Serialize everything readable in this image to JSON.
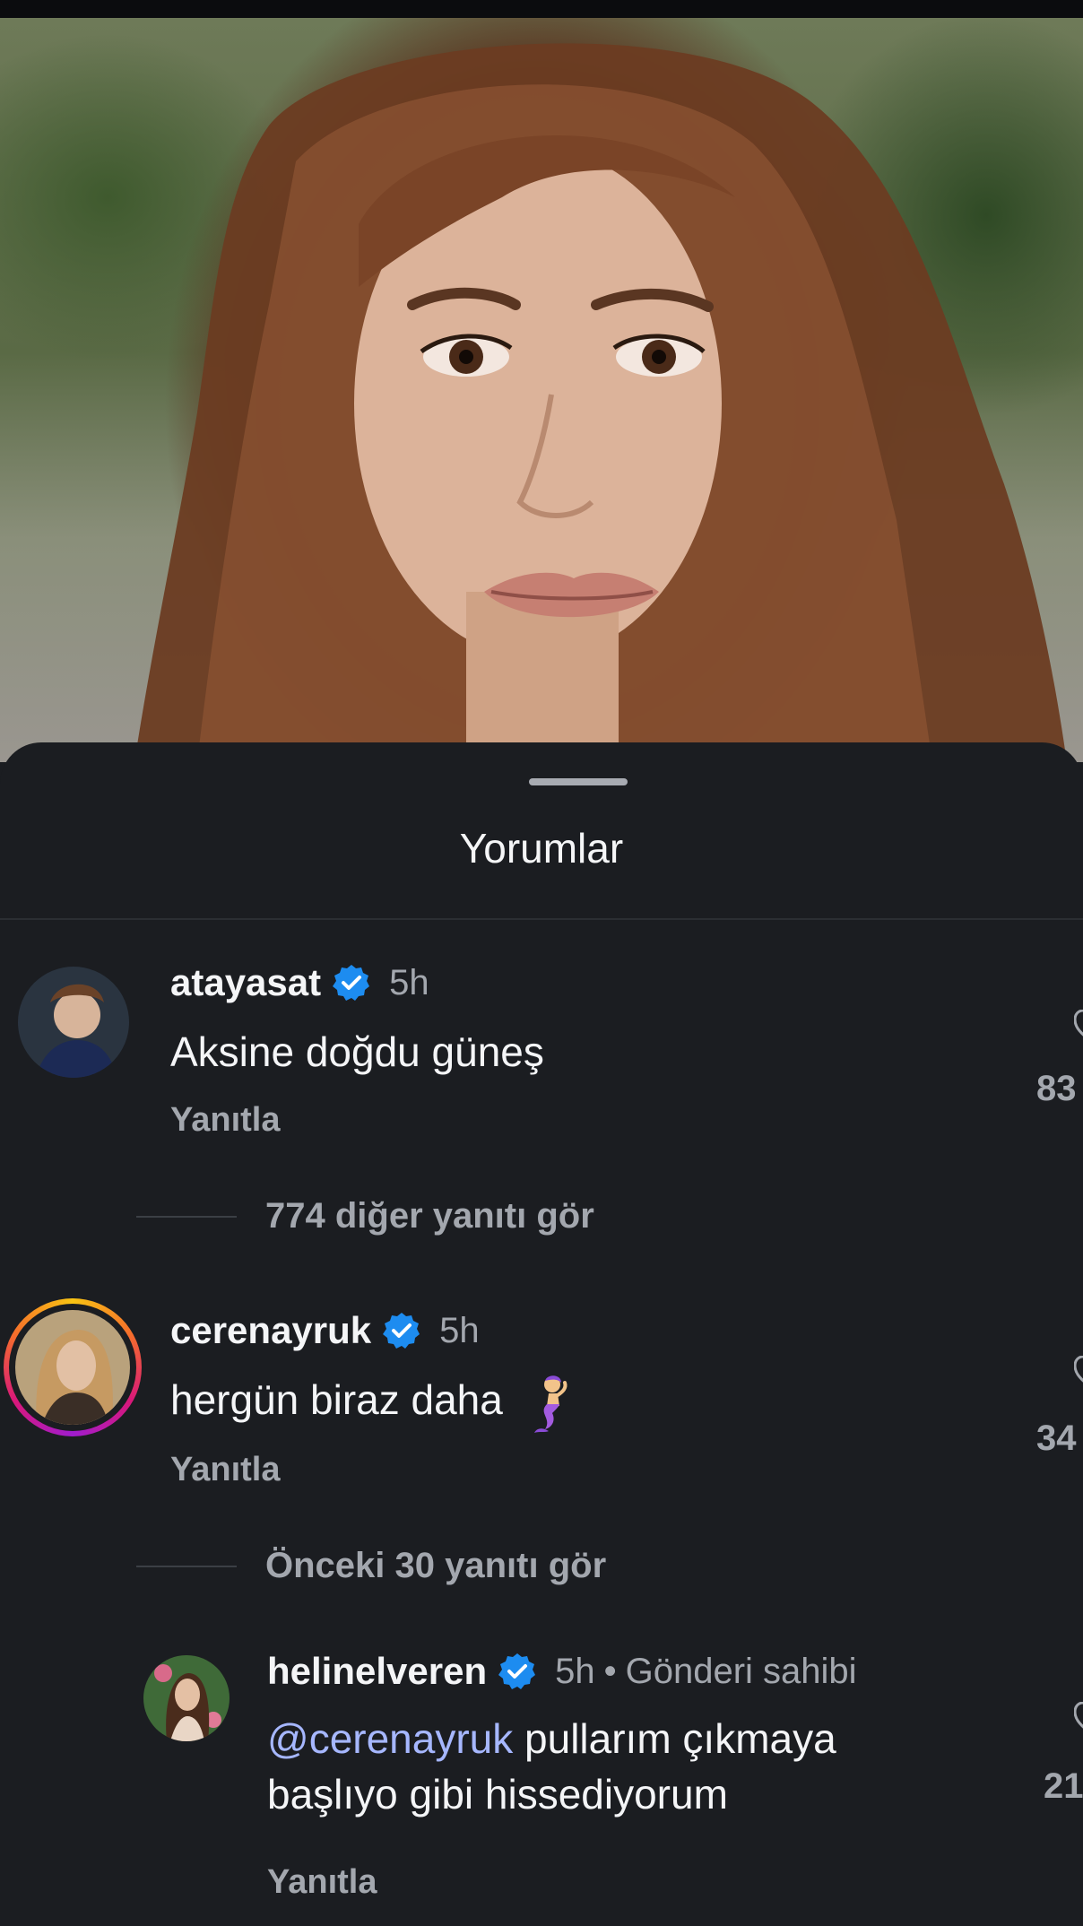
{
  "sheet": {
    "title": "Yorumlar"
  },
  "comments": [
    {
      "username": "atayasat",
      "verified": true,
      "time": "5h",
      "text": "Aksine doğdu güneş",
      "reply_label": "Yanıtla",
      "likes": "83",
      "view_more": "774 diğer yanıtı gör"
    },
    {
      "username": "cerenayruk",
      "verified": true,
      "time": "5h",
      "text": "hergün biraz daha",
      "emoji": "mermaid",
      "reply_label": "Yanıtla",
      "likes": "34",
      "view_more": "Önceki 30 yanıtı gör"
    }
  ],
  "reply": {
    "username": "helinelveren",
    "verified": true,
    "time": "5h",
    "separator": "•",
    "owner_tag": "Gönderi sahibi",
    "mention": "@cerenayruk",
    "text_line1": "pullarım çıkmaya",
    "text_line2": "başlıyo gibi hissediyorum",
    "reply_label": "Yanıtla",
    "likes": "21"
  },
  "colors": {
    "background": "#1b1d21",
    "verified_badge": "#1d8cf0",
    "mention": "#a6b7ff",
    "secondary_text": "#a3a7ae"
  }
}
